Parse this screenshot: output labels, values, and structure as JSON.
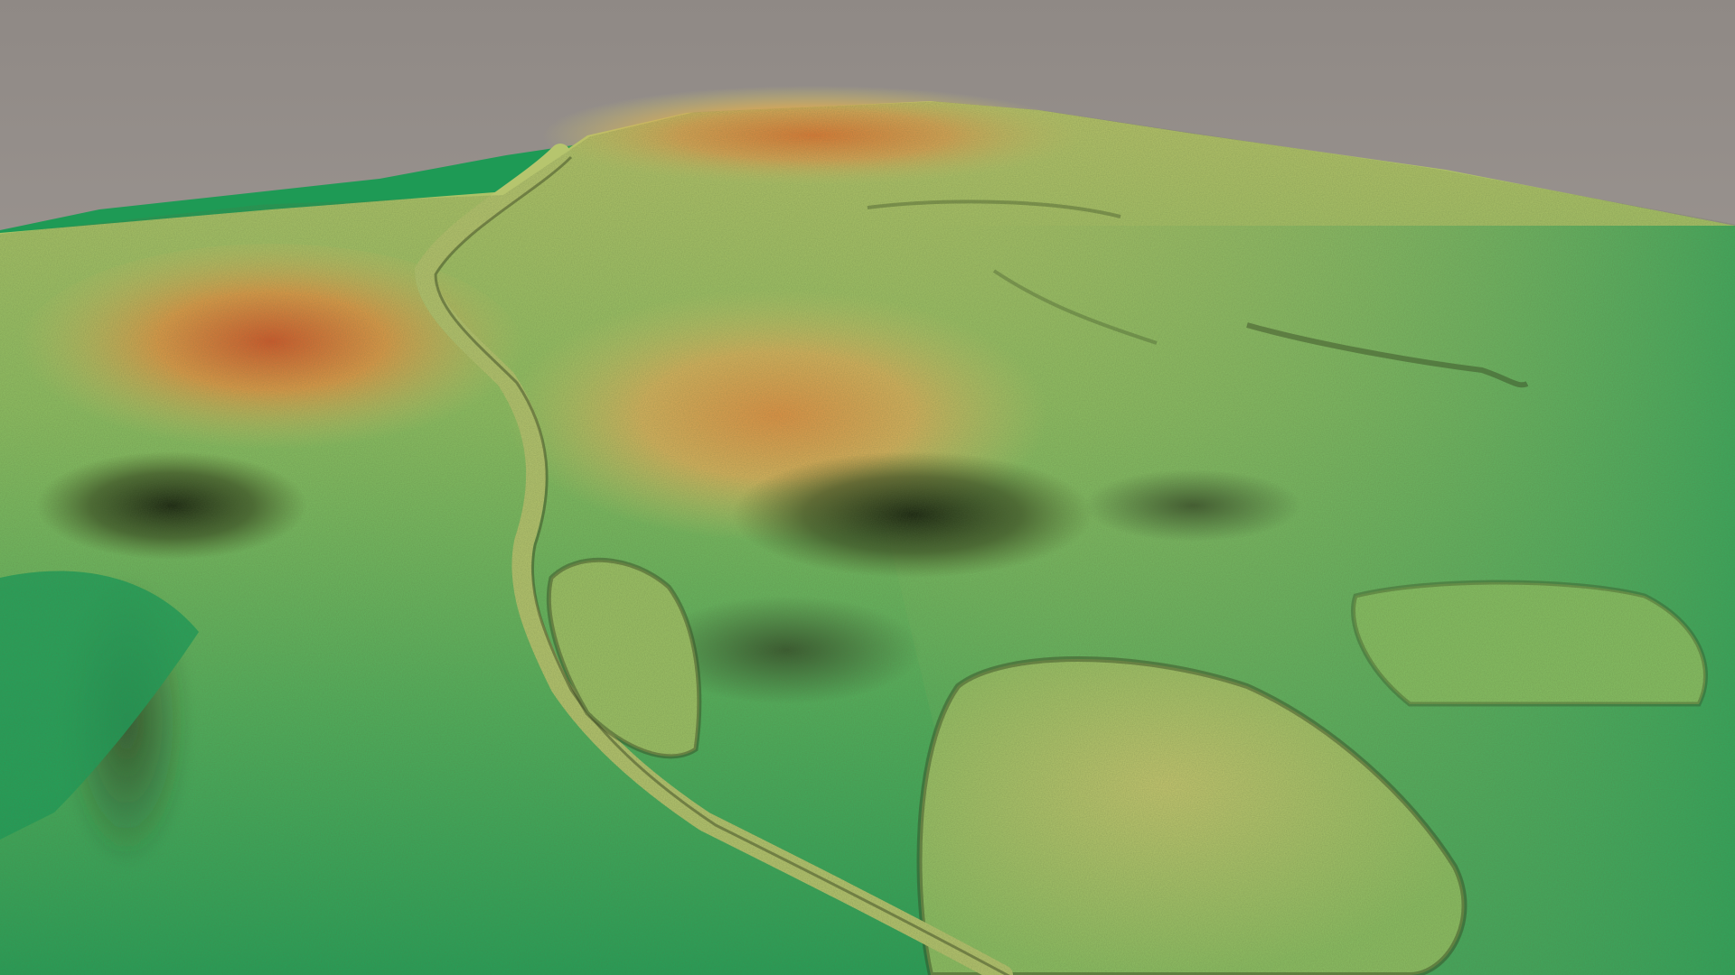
{
  "scene": {
    "kind": "lidar-terrain-relief-3d-view",
    "elevation_colormap": [
      "#0f9a56",
      "#3aa85a",
      "#7fbc5e",
      "#c2c86a",
      "#d9b45c",
      "#e08a3e",
      "#d45e2a"
    ],
    "sky_color": "#aaa49f",
    "shadow_color": "#1c2a12"
  }
}
